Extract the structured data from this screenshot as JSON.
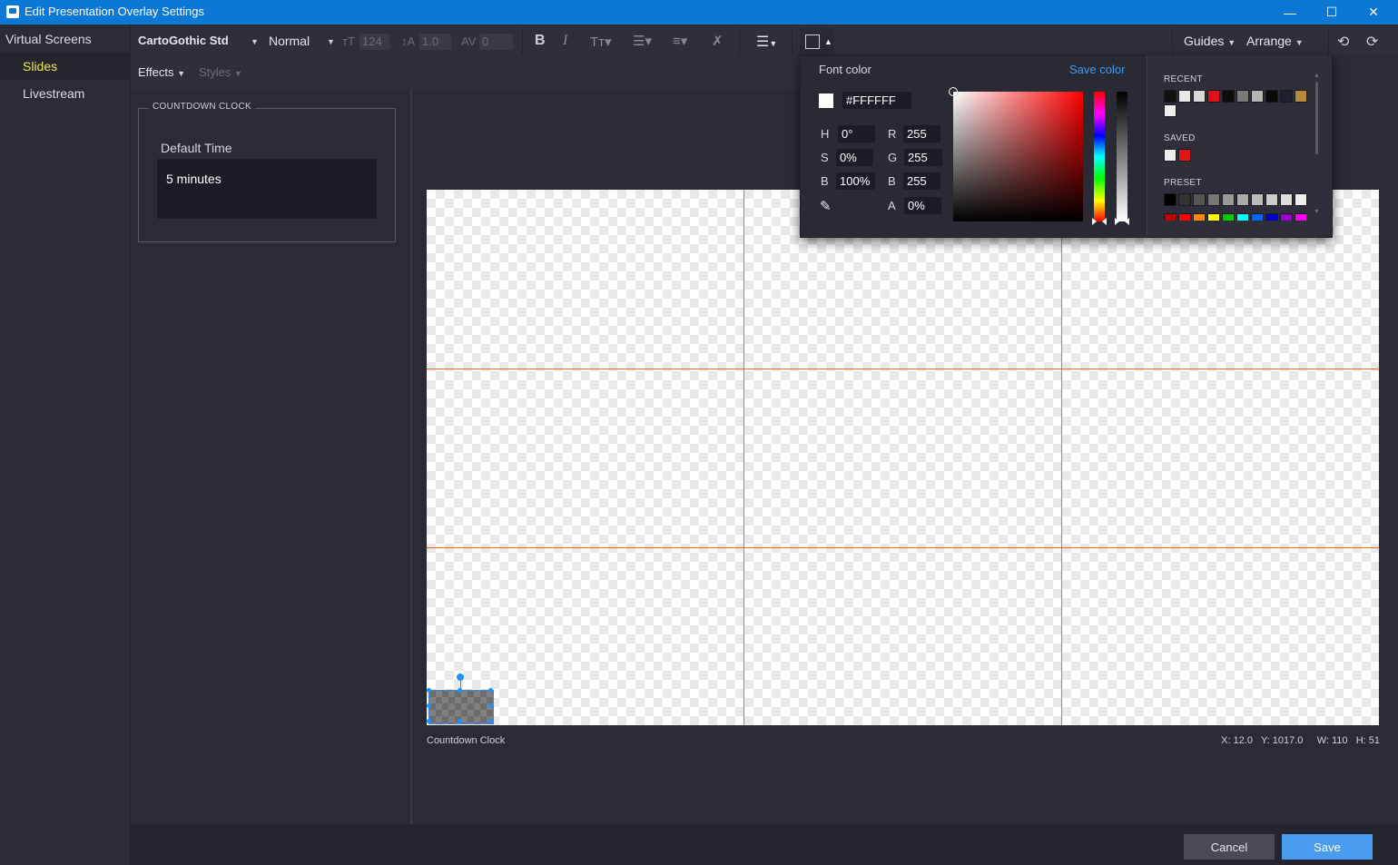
{
  "window": {
    "title": "Edit Presentation Overlay Settings",
    "minimize": "—",
    "maximize": "☐",
    "close": "✕"
  },
  "nav": {
    "items": [
      {
        "label": "Virtual Screens"
      },
      {
        "label": "Slides"
      },
      {
        "label": "Livestream"
      }
    ]
  },
  "toolbar": {
    "font_family": "CartoGothic Std",
    "font_weight": "Normal",
    "font_size": "124",
    "line_height": "1.0",
    "letter_spacing": "0",
    "effects": "Effects",
    "styles": "Styles",
    "guides": "Guides",
    "arrange": "Arrange"
  },
  "properties": {
    "group_title": "COUNTDOWN CLOCK",
    "field_label": "Default Time",
    "field_value": "5 minutes"
  },
  "canvas": {
    "element_name": "Countdown Clock",
    "metrics": "X: 12.0   Y: 1017.0     W: 110   H: 51"
  },
  "color_picker": {
    "title": "Font color",
    "save_color": "Save color",
    "hex": "#FFFFFF",
    "h_label": "H",
    "h": "0°",
    "s_label": "S",
    "s": "0%",
    "b_label": "B",
    "b": "100%",
    "r_label": "R",
    "r": "255",
    "g_label": "G",
    "g": "255",
    "b2_label": "B",
    "b2": "255",
    "a_label": "A",
    "a": "0%",
    "recent_label": "RECENT",
    "saved_label": "SAVED",
    "preset_label": "PRESET",
    "recent": [
      "#111111",
      "#e8e8e8",
      "#d9d9d9",
      "#e0101a",
      "#0d0d0d",
      "#7a7a7a",
      "#b5b5b5",
      "#0a0a0a",
      "#1f2030",
      "#b58a3a",
      "#eeeeee"
    ],
    "saved": [
      "#eeeeee",
      "#e01515"
    ],
    "preset_gray": [
      "#000000",
      "#333333",
      "#555555",
      "#777777",
      "#999999",
      "#aaaaaa",
      "#bbbbbb",
      "#cccccc",
      "#dddddd",
      "#eeeeee"
    ],
    "preset_color": [
      "#c00000",
      "#ff0000",
      "#ff8800",
      "#ffff00",
      "#00cc00",
      "#00ffff",
      "#0066ff",
      "#0000cc",
      "#9900cc",
      "#ff00ff"
    ]
  },
  "footer": {
    "cancel": "Cancel",
    "save": "Save"
  }
}
